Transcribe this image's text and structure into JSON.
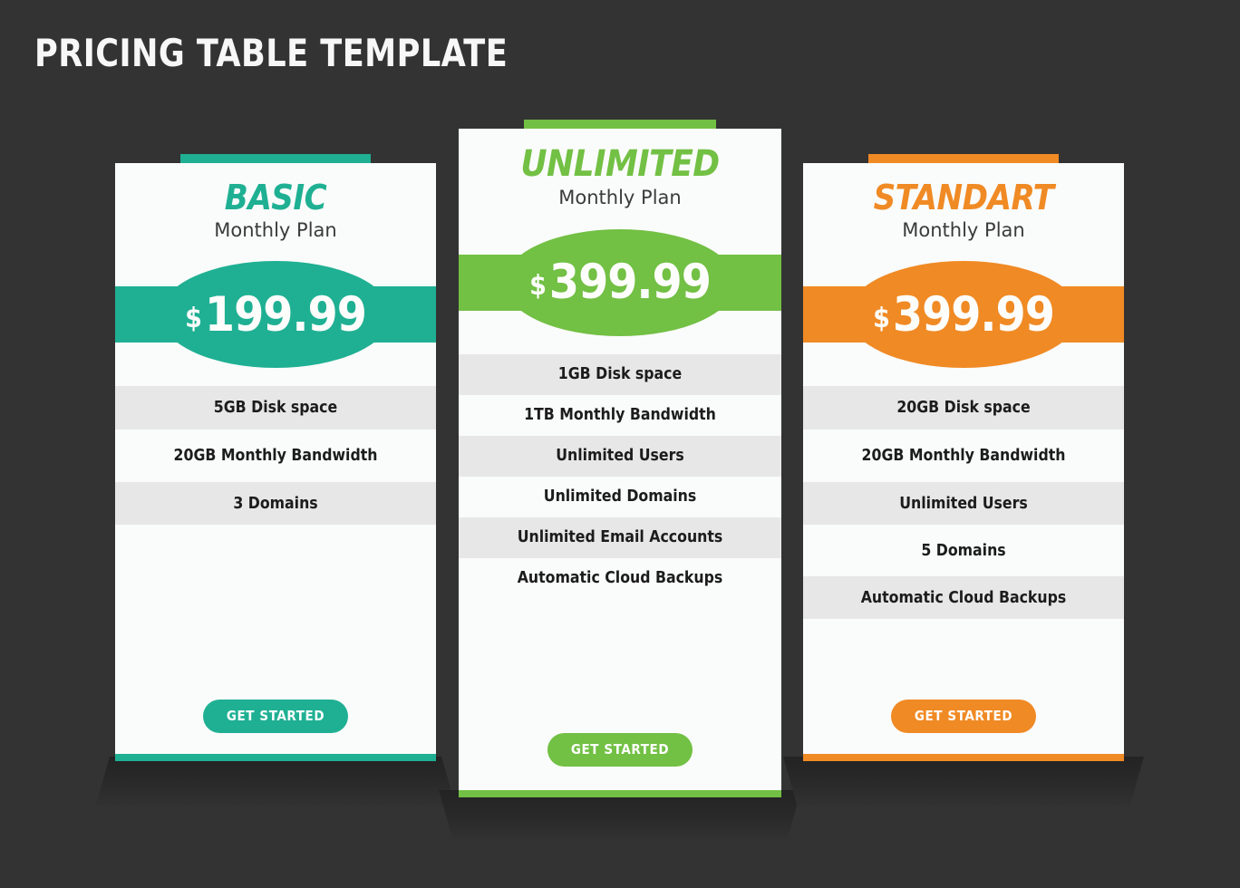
{
  "header": {
    "title": "PRICING TABLE TEMPLATE"
  },
  "theme": {
    "background": "#333333",
    "card_background": "#fafbfb",
    "stripe_color": "#e7e7e7",
    "text_color": "#1c1c1c",
    "title_color": "#f7f7f7"
  },
  "plans": [
    {
      "name": "BASIC",
      "subtitle": "Monthly Plan",
      "currency": "$",
      "price": "199.99",
      "accent": "#1fb093",
      "features": [
        "5GB Disk space",
        "20GB Monthly Bandwidth",
        "3 Domains"
      ],
      "cta": "GET STARTED"
    },
    {
      "name": "UNLIMITED",
      "subtitle": "Monthly Plan",
      "currency": "$",
      "price": "399.99",
      "accent": "#72c044",
      "features": [
        "1GB Disk space",
        "1TB Monthly Bandwidth",
        "Unlimited Users",
        "Unlimited Domains",
        "Unlimited Email Accounts",
        "Automatic Cloud Backups"
      ],
      "cta": "GET STARTED"
    },
    {
      "name": "STANDART",
      "subtitle": "Monthly Plan",
      "currency": "$",
      "price": "399.99",
      "accent": "#f08a24",
      "features": [
        "20GB Disk space",
        "20GB Monthly Bandwidth",
        "Unlimited Users",
        "5 Domains",
        "Automatic Cloud Backups"
      ],
      "cta": "GET STARTED"
    }
  ]
}
